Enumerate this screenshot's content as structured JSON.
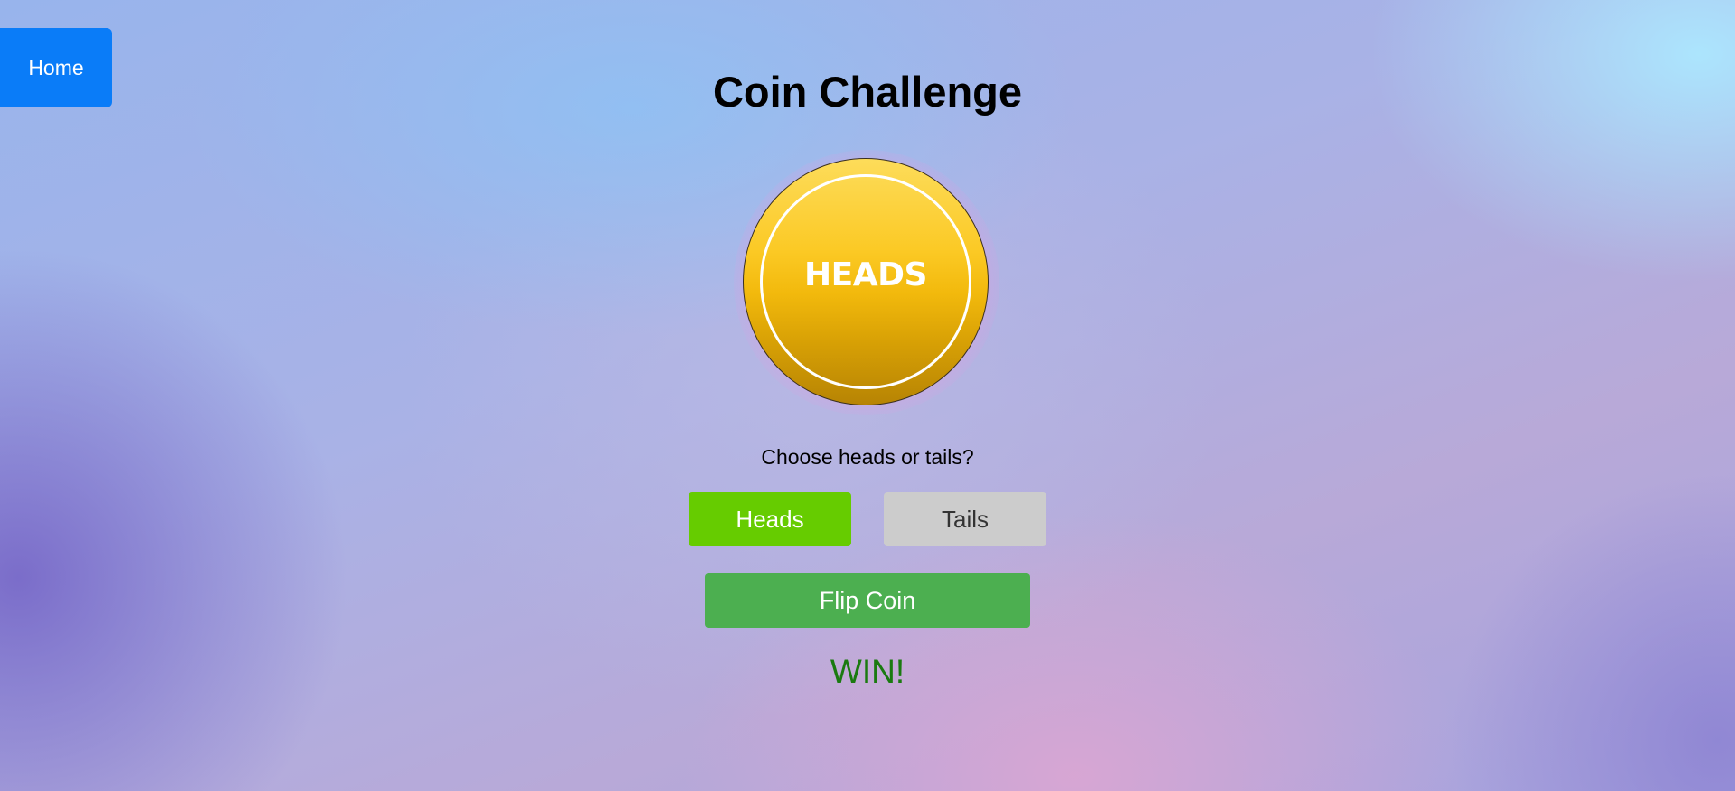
{
  "nav": {
    "home_label": "Home"
  },
  "game": {
    "title": "Coin Challenge",
    "coin_face": "HEADS",
    "prompt": "Choose heads or tails?",
    "choices": {
      "heads_label": "Heads",
      "tails_label": "Tails",
      "selected": "Heads"
    },
    "flip_label": "Flip Coin",
    "result": "WIN!"
  },
  "colors": {
    "home_button": "#0a7cf8",
    "heads_selected": "#66cc00",
    "tails_unselected": "#cccccc",
    "flip_button": "#4caf50",
    "result_text": "#1a7a10",
    "coin_gold": "#fbc924"
  }
}
